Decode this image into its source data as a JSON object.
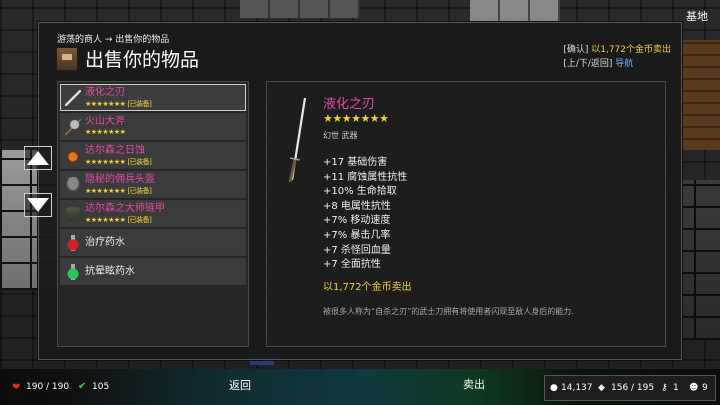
{
  "location_label": "基地",
  "breadcrumb": "游荡的商人 → 出售你的物品",
  "title": "出售你的物品",
  "hint": {
    "confirm_key": "[确认]",
    "confirm_text": "以1,772个金币卖出",
    "nav_keys": "[上/下/返回]",
    "nav_text": "导航"
  },
  "items": [
    {
      "name": "液化之刃",
      "stars": "★★★★★★★",
      "tag": "[已装备]",
      "icon": "blade-icon"
    },
    {
      "name": "火山大斧",
      "stars": "★★★★★★★",
      "tag": "",
      "icon": "axe-icon"
    },
    {
      "name": "达尔森之日蚀",
      "stars": "★★★★★★★",
      "tag": "[已装备]",
      "icon": "amulet-icon"
    },
    {
      "name": "隐秘的佣兵头盔",
      "stars": "★★★★★★★",
      "tag": "[已装备]",
      "icon": "helmet-icon"
    },
    {
      "name": "达尔森之大师链甲",
      "stars": "★★★★★★★",
      "tag": "[已装备]",
      "icon": "armor-icon"
    },
    {
      "name": "治疗药水",
      "icon": "red-potion-icon"
    },
    {
      "name": "抗晕眩药水",
      "icon": "green-potion-icon"
    }
  ],
  "detail": {
    "name": "液化之刃",
    "stars": "★★★★★★★",
    "type": "幻世 武器",
    "stats": [
      "+17 基础伤害",
      "+11 腐蚀属性抗性",
      "+10% 生命拾取",
      "+8 电属性抗性",
      "+7% 移动速度",
      "+7% 暴击几率",
      "+7 杀怪回血量",
      "+7 全面抗性"
    ],
    "price": "以1,772个金币卖出",
    "description": "被很多人称为“自杀之刃”的武士刀拥有将使用者闪现至敌人身后的能力."
  },
  "footer": {
    "hp": "190 / 190",
    "stamina": "105",
    "back": "返回",
    "sell": "卖出",
    "gold": "14,137",
    "gems": "156 / 195",
    "keys": "1",
    "cats": "9"
  },
  "colors": {
    "rare_item": "#e44aa4",
    "stars": "#f2d03a",
    "accent_blue": "#6fb4ff"
  }
}
